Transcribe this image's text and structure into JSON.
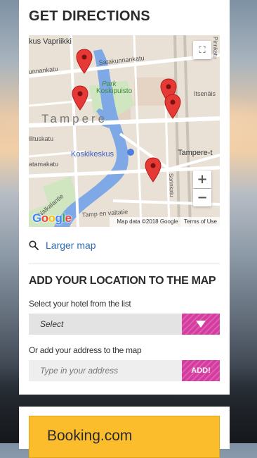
{
  "directions": {
    "title": "GET DIRECTIONS",
    "map": {
      "labels": {
        "vapriikki": "kus Vapriikki",
        "satakunnankatu": "Satakunnankatu",
        "unnankatu": "unnankatu",
        "park": "Park",
        "koskipuisto": "Koskipuisto",
        "itsenais": "Itsenäis",
        "tampere": "Tampere",
        "hiituskatu": "llituskatu",
        "koskikeskus": "Koskikeskus",
        "tampere_t": "Tampere-t",
        "atamakatu": "atamakatu",
        "sorinkatu": "Sorinkatu",
        "hameenpuisto": "Pinnkatu",
        "nalkalantori": "Nalkalantie",
        "valtatie": "Tamp    en valtatie"
      },
      "google": "Google",
      "map_data": "Map data ©2018 Google",
      "terms": "Terms of Use",
      "zoom_in": "+",
      "zoom_out": "−",
      "fullscreen_icon": "⛶"
    },
    "larger_map": "Larger map"
  },
  "location": {
    "title": "ADD YOUR LOCATION TO THE MAP",
    "hotel_label": "Select your hotel from the list",
    "select_value": "Select",
    "address_label": "Or add your address to the map",
    "address_placeholder": "Type in your address",
    "add_button": "ADD!"
  },
  "booking": {
    "label": "Booking.com"
  },
  "colors": {
    "accent": "#d63ba0",
    "link": "#2b6cb0",
    "booking": "#fbbd2c",
    "marker": "#e53935"
  }
}
